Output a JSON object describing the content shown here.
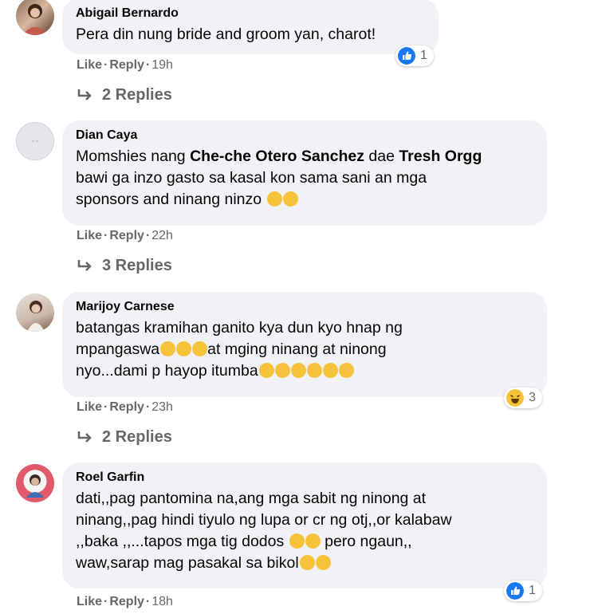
{
  "comments": [
    {
      "author": "Abigail Bernardo",
      "text": "Pera din nung bride and groom yan, charot!",
      "like": "Like",
      "reply": "Reply",
      "time": "19h",
      "reaction_count": "1",
      "reaction_type": "like",
      "replies": "2 Replies"
    },
    {
      "author": "Dian Caya",
      "text_a": "Momshies nang ",
      "mention_1": "Che-che Otero Sanchez",
      "text_b": " dae ",
      "mention_2": "Tresh Orgg",
      "text_c": "bawi ga inzo gasto sa kasal kon sama sani an mga",
      "text_d": "sponsors and ninang ninzo",
      "like": "Like",
      "reply": "Reply",
      "time": "22h",
      "replies": "3 Replies"
    },
    {
      "author": "Marijoy Carnese",
      "line_1": "batangas kramihan ganito kya dun kyo hnap ng",
      "line_2": "mpangaswa",
      "line_2b": "at mging ninang at ninong",
      "line_3": "nyo...dami p hayop itumba",
      "like": "Like",
      "reply": "Reply",
      "time": "23h",
      "reaction_count": "3",
      "reaction_type": "haha",
      "replies": "2 Replies"
    },
    {
      "author": "Roel Garfin",
      "line_1": "dati,,pag pantomina na,ang mga sabit ng ninong at",
      "line_2": "ninang,,pag hindi tiyulo ng lupa or cr ng otj,,or kalabaw",
      "line_3a": ",,baka ,,...tapos mga tig dodos ",
      "line_3b": "pero ngaun,,",
      "line_4": "waw,sarap mag pasakal sa bikol",
      "like": "Like",
      "reply": "Reply",
      "time": "18h",
      "reaction_count": "1",
      "reaction_type": "like"
    }
  ],
  "colors": {
    "bubble": "#f0f2f5",
    "meta_text": "#65676b",
    "like_blue": "#1877f2",
    "emoji_yellow": "#f7c23a"
  }
}
